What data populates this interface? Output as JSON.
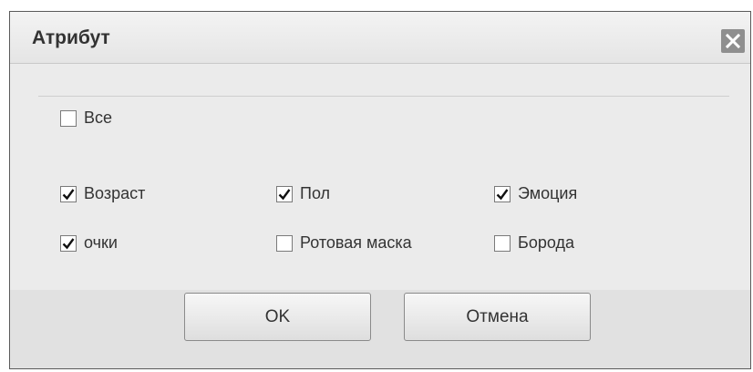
{
  "dialog": {
    "title": "Атрибут",
    "close_icon": "close-icon"
  },
  "all_option": {
    "label": "Все",
    "checked": false
  },
  "attributes": [
    {
      "label": "Возраст",
      "checked": true
    },
    {
      "label": "Пол",
      "checked": true
    },
    {
      "label": "Эмоция",
      "checked": true
    },
    {
      "label": "очки",
      "checked": true
    },
    {
      "label": "Ротовая маска",
      "checked": false
    },
    {
      "label": "Борода",
      "checked": false
    }
  ],
  "buttons": {
    "ok_label": "OK",
    "cancel_label": "Отмена"
  },
  "colors": {
    "dialog_bg": "#ebebeb",
    "footer_bg": "#e1e1e1",
    "text": "#333333",
    "close_bg": "#8f8f8f"
  }
}
